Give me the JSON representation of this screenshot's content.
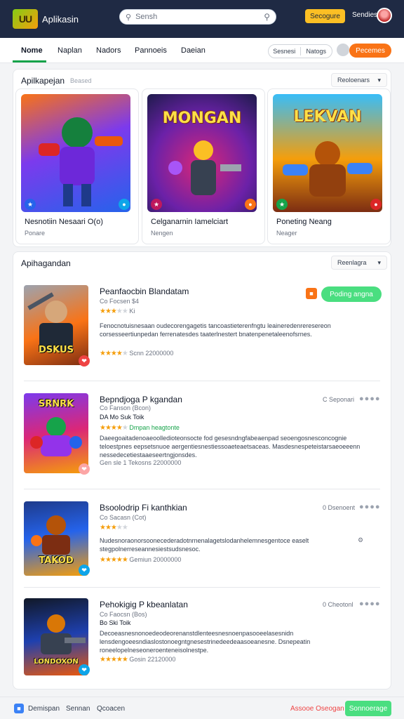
{
  "header": {
    "logo_text": "UU",
    "app_name": "Aplikasin",
    "search_placeholder": "Sensh",
    "primary_button": "Secogure",
    "link": "Sendies"
  },
  "tabs": {
    "items": [
      "Nome",
      "Naplan",
      "Nadors",
      "Pannoeis",
      "Daeian"
    ],
    "toggle": [
      "Sesnesi",
      "Natogs"
    ],
    "cta": "Pecemes"
  },
  "featured": {
    "title": "Apilkapejan",
    "subtitle": "Beased",
    "dropdown": "Reoloenars",
    "items": [
      {
        "name": "Nesnotiin Nesaari O(o)",
        "sub": "Ponare",
        "badge": "★",
        "art_text": ""
      },
      {
        "name": "Celganarnin Iamelciart",
        "sub": "Nengen",
        "badge": "★",
        "art_text": "MONGAN"
      },
      {
        "name": "Poneting Neang",
        "sub": "Neager",
        "badge": "★",
        "art_text": "LEKVAN"
      }
    ]
  },
  "list": {
    "title": "Apihagandan",
    "dropdown": "Reenlagra",
    "items": [
      {
        "title": "Peanfaocbin Blandatam",
        "meta": "Co Focsen $4",
        "rating_stars": 3.5,
        "rating_text": "Ki",
        "desc": "Fenocnotuisnesaan oudecorengagetis tancoastieterenfngtu leaineredenreresereon corsesseertiunpedan ferrenatesdes taaterlnestert bnatenpenetaleenofsrnes.",
        "foot_stars": 4,
        "foot_text": "Scnn 22000000",
        "thumb_label": "DSKUS",
        "right_label": "",
        "right_button": "Poding angna"
      },
      {
        "title": "Bepndjoga P kgandan",
        "meta": "Co Fanson (Bcon)",
        "meta2": "DA Mo Suk Toik",
        "rating_stars": 4.5,
        "rating_text": "Dmpan heagtonte",
        "desc": "Daeegoaitadenoaeoolledioteonsocte fod gesesndngfabeaenpad seoengosnesconcognie teloestpnes eepsetsnuoe aergentiesnestiessoaeteaetsaceas. Masdesnespeteistarsaeoeeenn nessedecetiestaaeseertngjonsdes.",
        "foot_stars": 0,
        "foot_text": "Gen sle 1 Tekosns 22000000",
        "thumb_label": "SRNRK",
        "right_label": "C Seponari",
        "right_button": ""
      },
      {
        "title": "Bsoolodrip Fi kanthkian",
        "meta": "Co Sacasn (Cot)",
        "meta2": "",
        "rating_stars": 3,
        "rating_text": "",
        "desc": "Nudesnoraonorsoonecederadotnrnenalagetslodanhelemnesgentoce easelt stegpolnerreseannesiestsudsnesoc.",
        "foot_stars": 5,
        "foot_text": "Gemiun 20000000",
        "thumb_label": "TAKOD",
        "right_label": "0 Dsenoent",
        "right_button": ""
      },
      {
        "title": "Pehokigig P kbeanlatan",
        "meta": "Co Faocsn (Bos)",
        "meta2": "Bo Ski Toik",
        "rating_stars": 0,
        "rating_text": "",
        "desc": "Decoeasnesnonoedeodeorenanstdlenteesnesnoenpasooeelasesnidn lensdengoeesndiaslostonoegntgnesestrinedeedeaasoeanesne. Dsnepeatin roneelopelneseoneroenteneisolnestpe.",
        "foot_stars": 5,
        "foot_text": "Gosin 22120000",
        "thumb_label": "LONDOXON",
        "right_label": "0 Cheotonl",
        "right_button": ""
      }
    ]
  },
  "footer": {
    "links": [
      "Demispan",
      "Sennan",
      "Qcoacen"
    ],
    "right_link": "Assooe Oseogan",
    "button": "Sonnoerage"
  },
  "colors": {
    "header_bg": "#1f2a44",
    "accent_green": "#16a34a",
    "accent_orange": "#f97316",
    "accent_yellow": "#fbbf24"
  }
}
